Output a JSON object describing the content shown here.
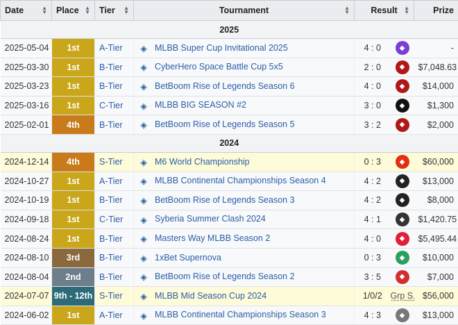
{
  "headers": {
    "date": "Date",
    "place": "Place",
    "tier": "Tier",
    "tournament": "Tournament",
    "result": "Result",
    "prize": "Prize"
  },
  "sections": [
    {
      "year": "2025",
      "rows": [
        {
          "date": "2025-05-04",
          "place": "1st",
          "pcls": "p1",
          "tier": "A-Tier",
          "icon": "diamond-icon",
          "tournament": "MLBB Super Cup Invitational 2025",
          "result": "4 : 0",
          "opp": "v-icon",
          "oppColor": "#7b3fd6",
          "prize": "-",
          "s": false
        },
        {
          "date": "2025-03-30",
          "place": "1st",
          "pcls": "p1",
          "tier": "B-Tier",
          "icon": "ch-icon",
          "tournament": "CyberHero Space Battle Cup 5x5",
          "result": "2 : 0",
          "opp": "fox-icon",
          "oppColor": "#b01818",
          "prize": "$7,048.63",
          "s": false
        },
        {
          "date": "2025-03-23",
          "place": "1st",
          "pcls": "p1",
          "tier": "B-Tier",
          "icon": "betboom-icon",
          "tournament": "BetBoom Rise of Legends Season 6",
          "result": "4 : 0",
          "opp": "fox-icon",
          "oppColor": "#b01818",
          "prize": "$14,000",
          "s": false
        },
        {
          "date": "2025-03-16",
          "place": "1st",
          "pcls": "p1",
          "tier": "C-Tier",
          "icon": "x-icon",
          "tournament": "MLBB BIG SEASON #2",
          "result": "3 : 0",
          "opp": "ch-icon",
          "oppColor": "#111111",
          "prize": "$1,300",
          "s": false
        },
        {
          "date": "2025-02-01",
          "place": "4th",
          "pcls": "p4",
          "tier": "B-Tier",
          "icon": "betboom-icon",
          "tournament": "BetBoom Rise of Legends Season 5",
          "result": "3 : 2",
          "opp": "fox-icon",
          "oppColor": "#b01818",
          "prize": "$2,000",
          "s": false
        }
      ]
    },
    {
      "year": "2024",
      "rows": [
        {
          "date": "2024-12-14",
          "place": "4th",
          "pcls": "p4",
          "tier": "S-Tier",
          "icon": "m6-icon",
          "tournament": "M6 World Championship",
          "result": "0 : 3",
          "opp": "flame-icon",
          "oppColor": "#e03010",
          "prize": "$60,000",
          "s": true
        },
        {
          "date": "2024-10-27",
          "place": "1st",
          "pcls": "p1",
          "tier": "A-Tier",
          "icon": "mcc-icon",
          "tournament": "MLBB Continental Championships Season 4",
          "result": "4 : 2",
          "opp": "skull-icon",
          "oppColor": "#222222",
          "prize": "$13,000",
          "s": false
        },
        {
          "date": "2024-10-19",
          "place": "1st",
          "pcls": "p1",
          "tier": "B-Tier",
          "icon": "betboom-icon",
          "tournament": "BetBoom Rise of Legends Season 3",
          "result": "4 : 2",
          "opp": "skull-icon",
          "oppColor": "#222222",
          "prize": "$8,000",
          "s": false
        },
        {
          "date": "2024-09-18",
          "place": "1st",
          "pcls": "p1",
          "tier": "C-Tier",
          "icon": "syberia-icon",
          "tournament": "Syberia Summer Clash 2024",
          "result": "4 : 1",
          "opp": "skull-icon",
          "oppColor": "#333333",
          "prize": "$1,420.75",
          "s": false
        },
        {
          "date": "2024-08-24",
          "place": "1st",
          "pcls": "p1",
          "tier": "B-Tier",
          "icon": "mw-icon",
          "tournament": "Masters Way MLBB Season 2",
          "result": "4 : 0",
          "opp": "bb-icon",
          "oppColor": "#e0203a",
          "prize": "$5,495.44",
          "s": false
        },
        {
          "date": "2024-08-10",
          "place": "3rd",
          "pcls": "p3",
          "tier": "B-Tier",
          "icon": "1xbet-icon",
          "tournament": "1xBet Supernova",
          "result": "0 : 3",
          "opp": "pair-icon",
          "oppColor": "#2aa060",
          "prize": "$10,000",
          "s": false
        },
        {
          "date": "2024-08-04",
          "place": "2nd",
          "pcls": "p2",
          "tier": "B-Tier",
          "icon": "betboom-icon",
          "tournament": "BetBoom Rise of Legends Season 2",
          "result": "3 : 5",
          "opp": "falcon-icon",
          "oppColor": "#d03030",
          "prize": "$7,000",
          "s": false
        },
        {
          "date": "2024-07-07",
          "place": "9th - 12th",
          "pcls": "p9",
          "tier": "S-Tier",
          "icon": "msc-icon",
          "tournament": "MLBB Mid Season Cup 2024",
          "result": "1/0/2",
          "opp": "Grp S.",
          "oppColor": "",
          "prize": "$56,000",
          "s": true
        },
        {
          "date": "2024-06-02",
          "place": "1st",
          "pcls": "p1",
          "tier": "A-Tier",
          "icon": "mcc-icon",
          "tournament": "MLBB Continental Championships Season 3",
          "result": "4 : 3",
          "opp": "crest-icon",
          "oppColor": "#777777",
          "prize": "$13,000",
          "s": false
        }
      ]
    }
  ]
}
